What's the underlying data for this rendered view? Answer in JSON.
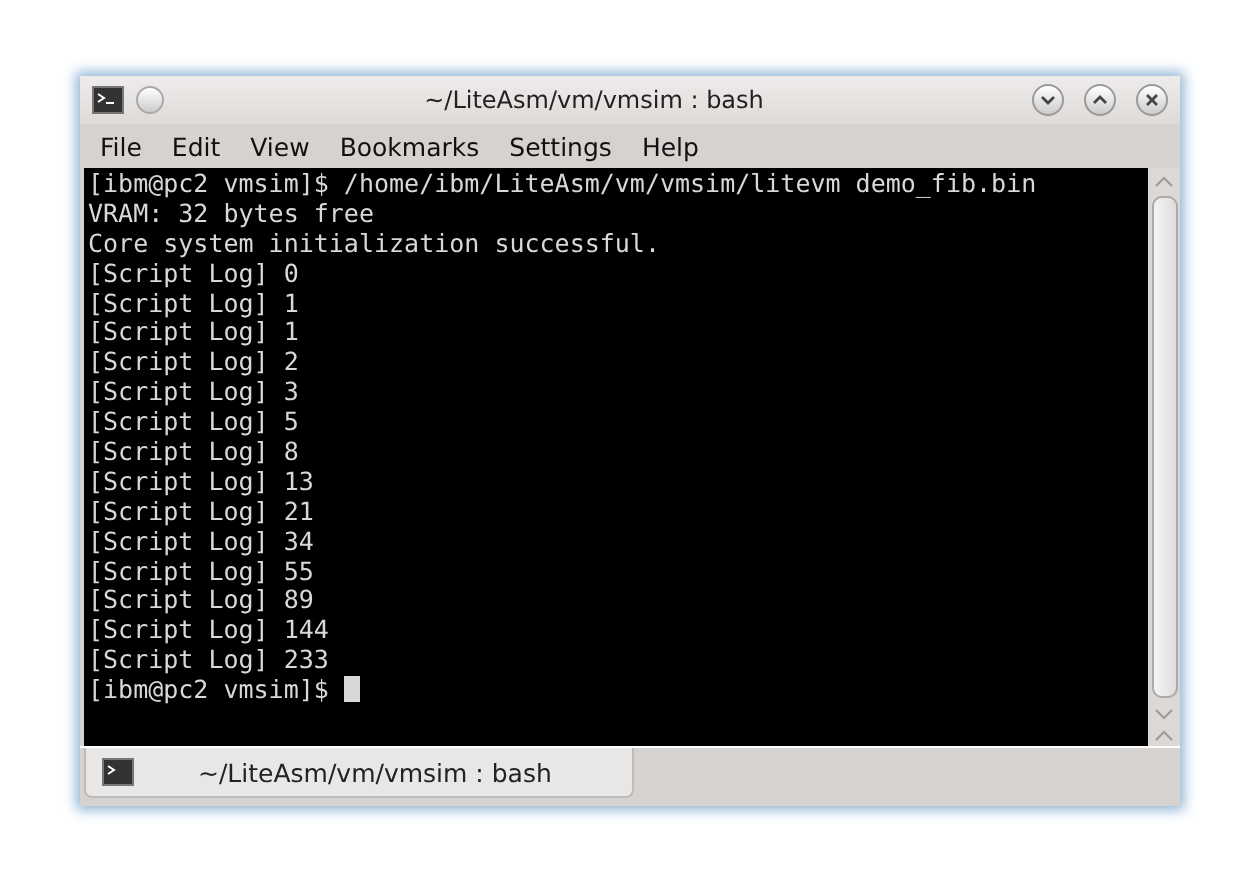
{
  "window": {
    "title": "~/LiteAsm/vm/vmsim : bash"
  },
  "menu": [
    "File",
    "Edit",
    "View",
    "Bookmarks",
    "Settings",
    "Help"
  ],
  "terminal": {
    "lines": [
      "[ibm@pc2 vmsim]$ /home/ibm/LiteAsm/vm/vmsim/litevm demo_fib.bin",
      "VRAM: 32 bytes free",
      "Core system initialization successful.",
      "[Script Log] 0",
      "[Script Log] 1",
      "[Script Log] 1",
      "[Script Log] 2",
      "[Script Log] 3",
      "[Script Log] 5",
      "[Script Log] 8",
      "[Script Log] 13",
      "[Script Log] 21",
      "[Script Log] 34",
      "[Script Log] 55",
      "[Script Log] 89",
      "[Script Log] 144",
      "[Script Log] 233"
    ],
    "prompt": "[ibm@pc2 vmsim]$ "
  },
  "tabs": [
    {
      "label": "~/LiteAsm/vm/vmsim : bash",
      "selected": true
    }
  ]
}
